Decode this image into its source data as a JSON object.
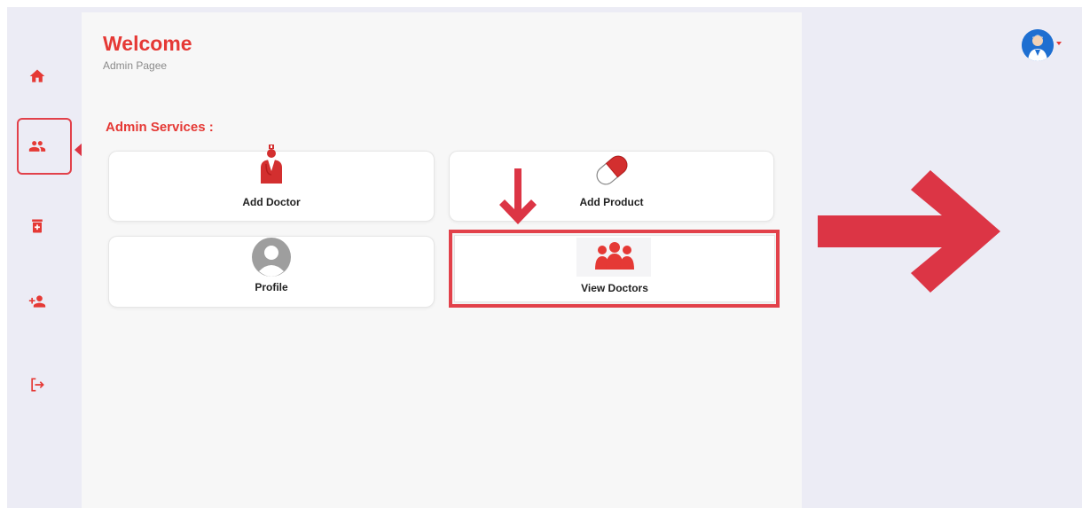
{
  "header": {
    "title": "Welcome",
    "subtitle": "Admin Pagee"
  },
  "services": {
    "label": "Admin Services :",
    "cards": [
      {
        "label": "Add Doctor",
        "icon": "doctor-icon"
      },
      {
        "label": "Add Product",
        "icon": "pill-capsule-icon"
      },
      {
        "label": "Profile",
        "icon": "profile-avatar-icon"
      },
      {
        "label": "View Doctors",
        "icon": "group-users-icon"
      }
    ]
  },
  "sidebar": {
    "items": [
      {
        "icon": "home-icon"
      },
      {
        "icon": "users-icon",
        "highlighted": true
      },
      {
        "icon": "medicine-box-icon"
      },
      {
        "icon": "add-user-icon"
      },
      {
        "icon": "logout-icon"
      }
    ]
  },
  "user_menu": {
    "avatar_icon": "doctor-avatar-icon",
    "dropdown_icon": "caret-down-icon"
  },
  "colors": {
    "accent": "#e53935",
    "annotation": "#dc3545",
    "background": "#ececf5",
    "main_background": "#f7f7f7"
  }
}
